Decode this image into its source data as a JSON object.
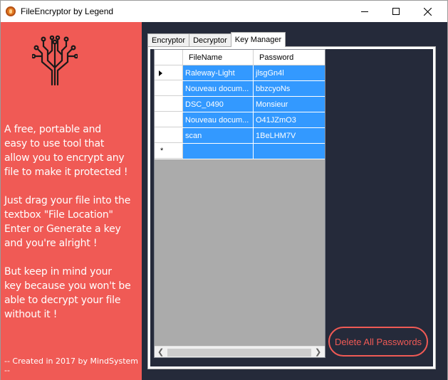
{
  "window": {
    "title": "FileEncryptor by Legend",
    "controls": {
      "minimize": "minimize",
      "maximize": "maximize",
      "close": "close"
    }
  },
  "sidebar": {
    "icon": "tree-circuit-icon",
    "paragraph1": [
      "A free, portable and",
      "easy to use tool that",
      "allow you to encrypt any",
      "file to make it protected !"
    ],
    "paragraph2": [
      "Just drag your file into the",
      "textbox \"File Location\"",
      "Enter or Generate a key",
      "and you're alright !"
    ],
    "paragraph3": [
      "But keep in mind your",
      "key because you won't be",
      "able to decrypt your file",
      "without it !"
    ],
    "credit": "-- Created in 2017 by MindSystem --",
    "color": "#f05a55"
  },
  "tabs": [
    {
      "label": "Encryptor",
      "active": false
    },
    {
      "label": "Decryptor",
      "active": false
    },
    {
      "label": "Key Manager",
      "active": true
    }
  ],
  "grid": {
    "columns": [
      "FileName",
      "Password"
    ],
    "rows": [
      {
        "filename": "Raleway-Light",
        "password": "jlsgGn4l",
        "current": true
      },
      {
        "filename": "Nouveau docum...",
        "password": "bbzcyoNs",
        "current": false
      },
      {
        "filename": "DSC_0490",
        "password": "Monsieur",
        "current": false
      },
      {
        "filename": "Nouveau docum...",
        "password": "O41JZmO3",
        "current": false
      },
      {
        "filename": "scan",
        "password": "1BeLHM7V",
        "current": false
      }
    ],
    "new_row_marker": "*",
    "selection_color": "#3399ff"
  },
  "actions": {
    "delete_all": "Delete All Passwords"
  },
  "colors": {
    "accent": "#f05a55",
    "background": "#252a3a"
  }
}
